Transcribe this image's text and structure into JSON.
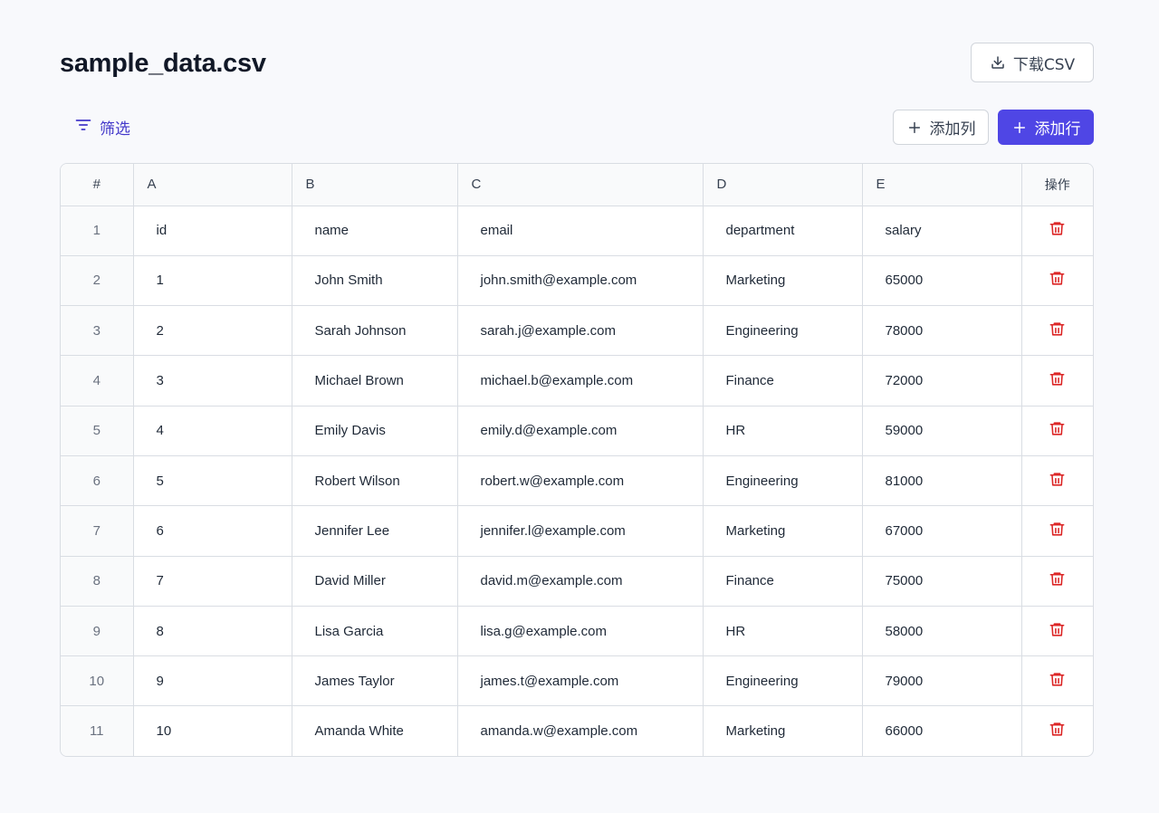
{
  "title": "sample_data.csv",
  "toolbar": {
    "download_label": "下载CSV",
    "filter_label": "筛选",
    "add_column_label": "添加列",
    "add_row_label": "添加行"
  },
  "colors": {
    "primary": "#4f46e5",
    "filter_text": "#4338ca",
    "delete_icon": "#dc2626"
  },
  "table": {
    "headers": [
      "#",
      "A",
      "B",
      "C",
      "D",
      "E",
      "操作"
    ],
    "rows": [
      {
        "num": "1",
        "cells": [
          "id",
          "name",
          "email",
          "department",
          "salary"
        ]
      },
      {
        "num": "2",
        "cells": [
          "1",
          "John Smith",
          "john.smith@example.com",
          "Marketing",
          "65000"
        ]
      },
      {
        "num": "3",
        "cells": [
          "2",
          "Sarah Johnson",
          "sarah.j@example.com",
          "Engineering",
          "78000"
        ]
      },
      {
        "num": "4",
        "cells": [
          "3",
          "Michael Brown",
          "michael.b@example.com",
          "Finance",
          "72000"
        ]
      },
      {
        "num": "5",
        "cells": [
          "4",
          "Emily Davis",
          "emily.d@example.com",
          "HR",
          "59000"
        ]
      },
      {
        "num": "6",
        "cells": [
          "5",
          "Robert Wilson",
          "robert.w@example.com",
          "Engineering",
          "81000"
        ]
      },
      {
        "num": "7",
        "cells": [
          "6",
          "Jennifer Lee",
          "jennifer.l@example.com",
          "Marketing",
          "67000"
        ]
      },
      {
        "num": "8",
        "cells": [
          "7",
          "David Miller",
          "david.m@example.com",
          "Finance",
          "75000"
        ]
      },
      {
        "num": "9",
        "cells": [
          "8",
          "Lisa Garcia",
          "lisa.g@example.com",
          "HR",
          "58000"
        ]
      },
      {
        "num": "10",
        "cells": [
          "9",
          "James Taylor",
          "james.t@example.com",
          "Engineering",
          "79000"
        ]
      },
      {
        "num": "11",
        "cells": [
          "10",
          "Amanda White",
          "amanda.w@example.com",
          "Marketing",
          "66000"
        ]
      }
    ]
  }
}
